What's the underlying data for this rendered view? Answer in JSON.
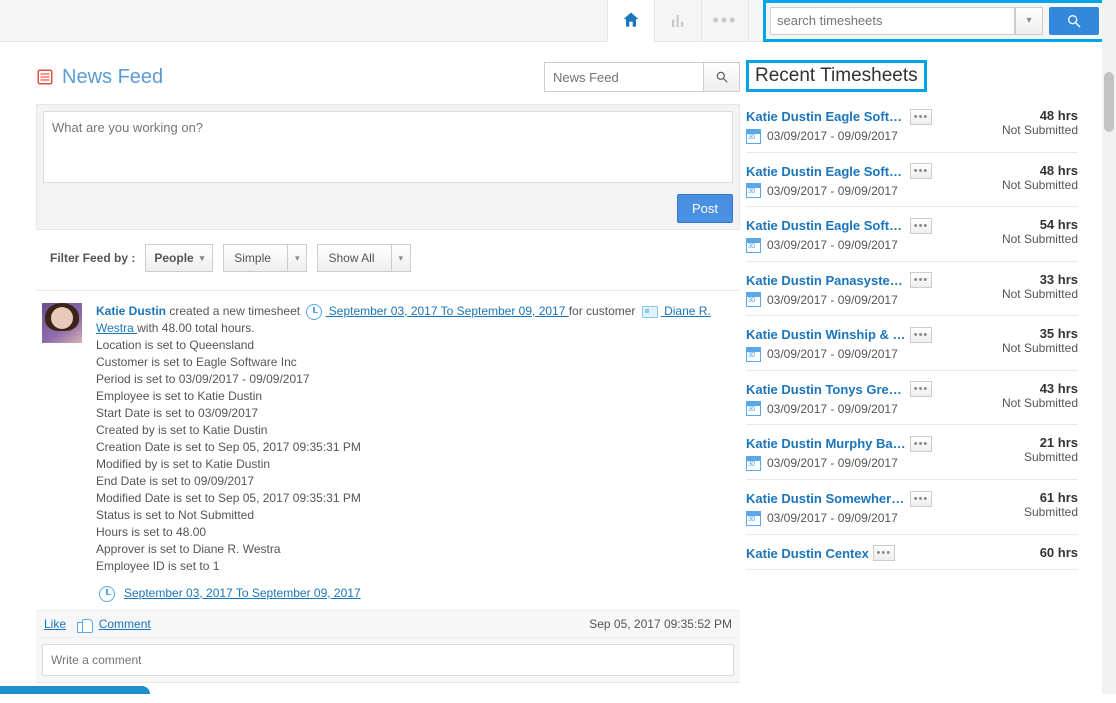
{
  "topbar": {
    "search_placeholder": "search timesheets"
  },
  "newsfeed": {
    "title": "News Feed",
    "search_placeholder": "News Feed",
    "composer_placeholder": "What are you working on?",
    "post_label": "Post",
    "filter_label": "Filter Feed by :",
    "filter_people": "People",
    "filter_simple": "Simple",
    "filter_showall": "Show All"
  },
  "feed_item": {
    "author": "Katie Dustin",
    "action": " created a new timesheet ",
    "period_link": " September 03, 2017 To September 09, 2017 ",
    "for_customer": "for customer ",
    "customer_link": " Diane R. Westra ",
    "tail": "with 48.00 total hours.",
    "lines": [
      "Location is set to Queensland",
      "Customer is set to Eagle Software Inc",
      "Period is set to 03/09/2017 - 09/09/2017",
      "Employee is set to Katie Dustin",
      "Start Date is set to 03/09/2017",
      "Created by is set to Katie Dustin",
      "Creation Date is set to Sep 05, 2017 09:35:31 PM",
      "Modified by is set to Katie Dustin",
      "End Date is set to 09/09/2017",
      "Modified Date is set to Sep 05, 2017 09:35:31 PM",
      "Status is set to Not Submitted",
      "Hours is set to 48.00",
      "Approver is set to Diane R. Westra",
      "Employee ID is set to 1"
    ],
    "period_link2": "September 03, 2017 To September 09, 2017",
    "like": "Like",
    "comment": "Comment",
    "timestamp": "Sep 05, 2017 09:35:52 PM",
    "comment_placeholder": "Write a comment"
  },
  "sidebar": {
    "panel_title": "Recent Timesheets",
    "items": [
      {
        "title": "Katie Dustin Eagle Softwar...",
        "date": "03/09/2017 - 09/09/2017",
        "hrs": "48 hrs",
        "status": "Not Submitted"
      },
      {
        "title": "Katie Dustin Eagle Softwar...",
        "date": "03/09/2017 - 09/09/2017",
        "hrs": "48 hrs",
        "status": "Not Submitted"
      },
      {
        "title": "Katie Dustin Eagle Softwar...",
        "date": "03/09/2017 - 09/09/2017",
        "hrs": "54 hrs",
        "status": "Not Submitted"
      },
      {
        "title": "Katie Dustin Panasystems",
        "date": "03/09/2017 - 09/09/2017",
        "hrs": "33 hrs",
        "status": "Not Submitted"
      },
      {
        "title": "Katie Dustin Winship & By...",
        "date": "03/09/2017 - 09/09/2017",
        "hrs": "35 hrs",
        "status": "Not Submitted"
      },
      {
        "title": "Katie Dustin Tonys Greenery",
        "date": "03/09/2017 - 09/09/2017",
        "hrs": "43 hrs",
        "status": "Not Submitted"
      },
      {
        "title": "Katie Dustin Murphy Battis...",
        "date": "03/09/2017 - 09/09/2017",
        "hrs": "21 hrs",
        "status": "Submitted"
      },
      {
        "title": "Katie Dustin Somewhere in...",
        "date": "03/09/2017 - 09/09/2017",
        "hrs": "61 hrs",
        "status": "Submitted"
      },
      {
        "title": "Katie Dustin Centex",
        "date": "",
        "hrs": "60 hrs",
        "status": ""
      }
    ]
  }
}
